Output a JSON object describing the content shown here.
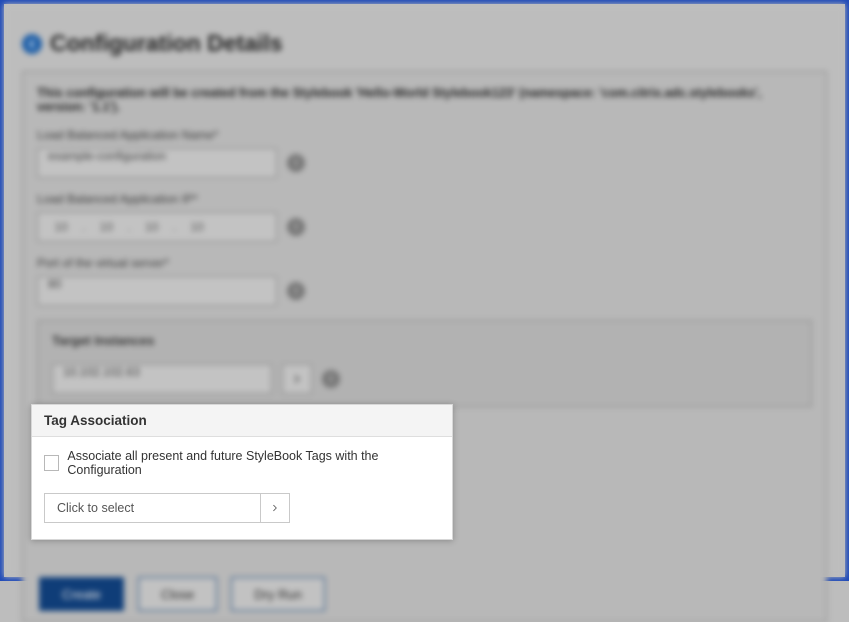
{
  "header": {
    "title": "Configuration Details",
    "backIcon": "back-arrow-icon"
  },
  "config": {
    "description": "This configuration will be created from the Stylebook 'Hello-World Stylebook123' (namespace: 'com.citrix.adc.stylebooks', version: '1.1').",
    "fields": {
      "name": {
        "label": "Load Balanced Application Name*",
        "value": "example-configuration"
      },
      "ip": {
        "label": "Load Balanced Application IP*",
        "segments": [
          "10",
          "10",
          "10",
          "10"
        ]
      },
      "port": {
        "label": "Port of the virtual server*",
        "value": "80"
      }
    },
    "target": {
      "title": "Target Instances",
      "value": "10.102.102.63"
    }
  },
  "popover": {
    "title": "Tag Association",
    "checkboxLabel": "Associate all present and future StyleBook Tags with the Configuration",
    "selectPlaceholder": "Click to select"
  },
  "buttons": {
    "create": "Create",
    "close": "Close",
    "dryrun": "Dry Run"
  }
}
